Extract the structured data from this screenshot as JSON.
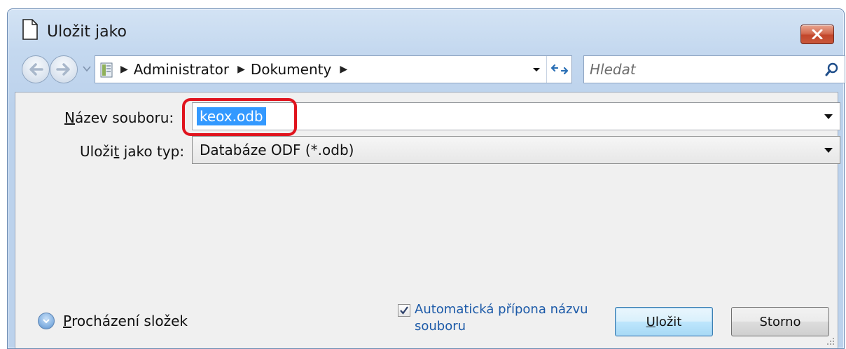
{
  "window": {
    "title": "Uložit jako",
    "close_icon": "close-icon"
  },
  "nav": {
    "breadcrumbs": [
      "Administrator",
      "Dokumenty"
    ],
    "search_placeholder": "Hledat"
  },
  "form": {
    "filename_label_pre": "N",
    "filename_label_post": "ázev soubor",
    "filename_label_tail": "u:",
    "filename_value": "keox.odb",
    "type_label_pre": "Uloži",
    "type_label_u": "t",
    "type_label_post": " jako typ:",
    "type_value": "Databáze ODF (*.odb)"
  },
  "footer": {
    "browse_label_u": "P",
    "browse_label_rest": "rocházení složek",
    "auto_extension_label": "Automatická přípona názvu souboru",
    "auto_extension_checked": true,
    "save_label_u": "U",
    "save_label_rest": "ložit",
    "cancel_label": "Storno"
  },
  "colors": {
    "selection": "#3399ff",
    "highlight_ring": "#e0141e",
    "link_blue": "#1c5aa8"
  }
}
